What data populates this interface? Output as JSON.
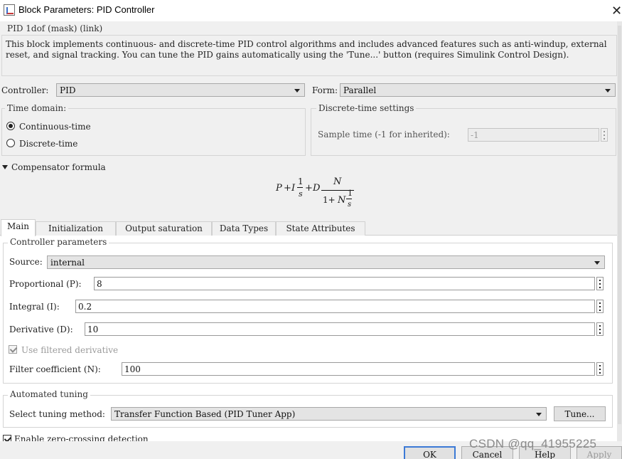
{
  "window": {
    "title": "Block Parameters: PID Controller"
  },
  "description": {
    "title": "PID 1dof (mask) (link)",
    "text": "This block implements continuous- and discrete-time PID control algorithms and includes advanced features such as anti-windup, external reset, and signal tracking. You can tune the PID gains automatically using the 'Tune...' button (requires Simulink Control Design)."
  },
  "controller": {
    "label": "Controller:",
    "value": "PID"
  },
  "form": {
    "label": "Form:",
    "value": "Parallel"
  },
  "time_domain": {
    "legend": "Time domain:",
    "options": [
      {
        "label": "Continuous-time",
        "selected": true
      },
      {
        "label": "Discrete-time",
        "selected": false
      }
    ]
  },
  "discrete_settings": {
    "legend": "Discrete-time settings",
    "sample_time_label": "Sample time (-1 for inherited):",
    "sample_time_value": "-1"
  },
  "compensator": {
    "label": "Compensator formula",
    "formula": {
      "p": "P",
      "plus1": "+",
      "i": "I",
      "one": "1",
      "s": "s",
      "plus2": "+",
      "d": "D",
      "n_num": "N",
      "den_one": "1+",
      "n_den": "N",
      "one2": "1",
      "s2": "s"
    }
  },
  "tabs": [
    {
      "label": "Main",
      "active": true
    },
    {
      "label": "Initialization",
      "active": false
    },
    {
      "label": "Output saturation",
      "active": false
    },
    {
      "label": "Data Types",
      "active": false
    },
    {
      "label": "State Attributes",
      "active": false
    }
  ],
  "controller_parameters": {
    "legend": "Controller parameters",
    "source_label": "Source:",
    "source_value": "internal",
    "proportional_label": "Proportional (P):",
    "proportional_value": "8",
    "integral_label": "Integral (I):",
    "integral_value": "0.2",
    "derivative_label": "Derivative (D):",
    "derivative_value": "10",
    "use_filtered_label": "Use filtered derivative",
    "use_filtered_checked": true,
    "filter_label": "Filter coefficient (N):",
    "filter_value": "100"
  },
  "automated_tuning": {
    "legend": "Automated tuning",
    "method_label": "Select tuning method:",
    "method_value": "Transfer Function Based (PID Tuner App)",
    "tune_button": "Tune..."
  },
  "zero_crossing": {
    "label": "Enable zero-crossing detection",
    "checked": true
  },
  "buttons": {
    "ok": "OK",
    "cancel": "Cancel",
    "help": "Help",
    "apply": "Apply"
  },
  "watermark": "CSDN @qq_41955225"
}
